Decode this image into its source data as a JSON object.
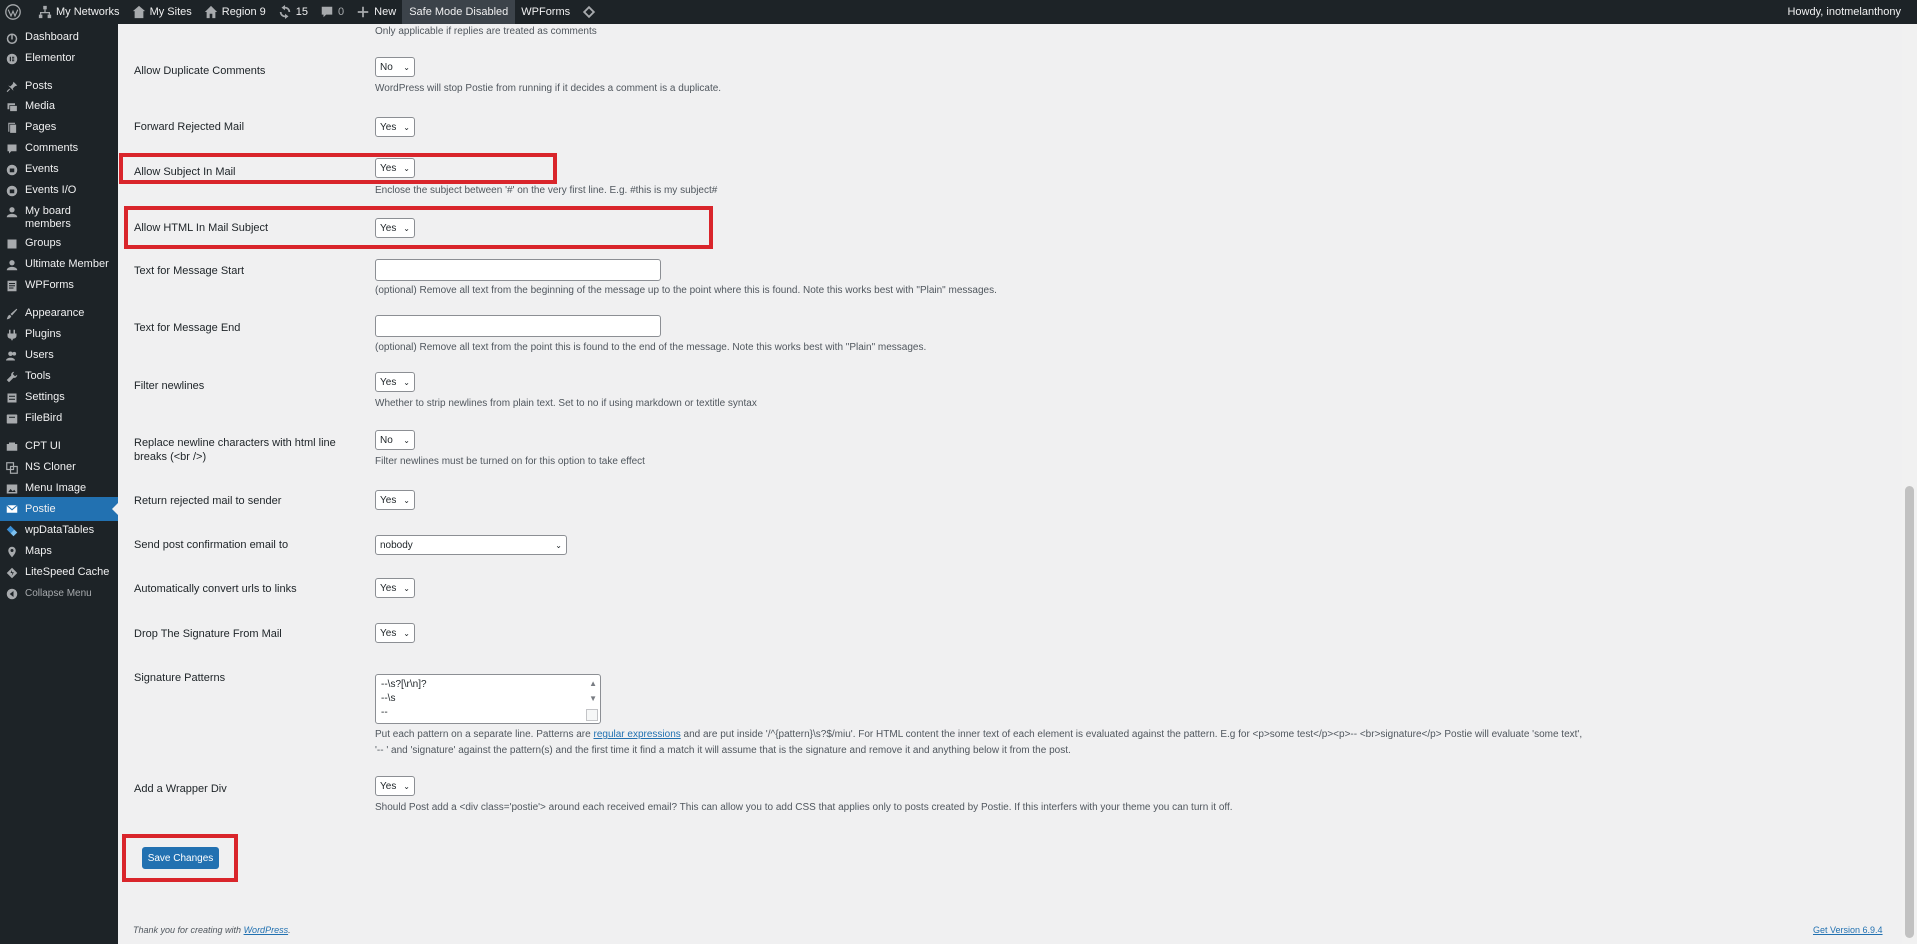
{
  "adminbar": {
    "my_networks": "My Networks",
    "my_sites": "My Sites",
    "site": "Region 9",
    "updates": "15",
    "comments": "0",
    "new": "New",
    "safe_mode": "Safe Mode Disabled",
    "wpforms": "WPForms",
    "howdy": "Howdy, inotmelanthony"
  },
  "sidebar": {
    "items": [
      {
        "label": "Dashboard",
        "icon": "dashboard-icon"
      },
      {
        "label": "Elementor",
        "icon": "elementor-icon"
      },
      {
        "label": "Posts",
        "icon": "pin-icon"
      },
      {
        "label": "Media",
        "icon": "media-icon"
      },
      {
        "label": "Pages",
        "icon": "pages-icon"
      },
      {
        "label": "Comments",
        "icon": "comment-icon"
      },
      {
        "label": "Events",
        "icon": "events-icon"
      },
      {
        "label": "Events I/O",
        "icon": "events-io-icon"
      },
      {
        "label": "My board members",
        "icon": "person-icon"
      },
      {
        "label": "Groups",
        "icon": "groups-icon"
      },
      {
        "label": "Ultimate Member",
        "icon": "user-icon"
      },
      {
        "label": "WPForms",
        "icon": "forms-icon"
      },
      {
        "label": "Appearance",
        "icon": "brush-icon"
      },
      {
        "label": "Plugins",
        "icon": "plugin-icon"
      },
      {
        "label": "Users",
        "icon": "users-icon"
      },
      {
        "label": "Tools",
        "icon": "wrench-icon"
      },
      {
        "label": "Settings",
        "icon": "settings-icon"
      },
      {
        "label": "FileBird",
        "icon": "folder-icon"
      },
      {
        "label": "CPT UI",
        "icon": "cpt-icon"
      },
      {
        "label": "NS Cloner",
        "icon": "cloner-icon"
      },
      {
        "label": "Menu Image",
        "icon": "image-icon"
      },
      {
        "label": "Postie",
        "icon": "mail-icon"
      },
      {
        "label": "wpDataTables",
        "icon": "table-icon"
      },
      {
        "label": "Maps",
        "icon": "map-pin-icon"
      },
      {
        "label": "LiteSpeed Cache",
        "icon": "litespeed-icon"
      },
      {
        "label": "Collapse Menu",
        "icon": "collapse-icon"
      }
    ]
  },
  "settings": {
    "top_note": "Only applicable if replies are treated as comments",
    "allow_duplicate": {
      "label": "Allow Duplicate Comments",
      "value": "No",
      "desc": "WordPress will stop Postie from running if it decides a comment is a duplicate."
    },
    "forward_rejected": {
      "label": "Forward Rejected Mail",
      "value": "Yes"
    },
    "allow_subject": {
      "label": "Allow Subject In Mail",
      "value": "Yes",
      "desc": "Enclose the subject between '#' on the very first line. E.g. #this is my subject#"
    },
    "allow_html_subject": {
      "label": "Allow HTML In Mail Subject",
      "value": "Yes"
    },
    "message_start": {
      "label": "Text for Message Start",
      "value": "",
      "desc": "(optional) Remove all text from the beginning of the message up to the point where this is found. Note this works best with \"Plain\" messages."
    },
    "message_end": {
      "label": "Text for Message End",
      "value": "",
      "desc": "(optional) Remove all text from the point this is found to the end of the message. Note this works best with \"Plain\" messages."
    },
    "filter_newlines": {
      "label": "Filter newlines",
      "value": "Yes",
      "desc": "Whether to strip newlines from plain text. Set to no if using markdown or textitle syntax"
    },
    "replace_newline": {
      "label_1": "Replace newline characters with html line",
      "label_2": "breaks (<br />)",
      "value": "No",
      "desc": "Filter newlines must be turned on for this option to take effect"
    },
    "return_rejected": {
      "label": "Return rejected mail to sender",
      "value": "Yes"
    },
    "send_confirmation": {
      "label": "Send post confirmation email to",
      "value": "nobody"
    },
    "convert_urls": {
      "label": "Automatically convert urls to links",
      "value": "Yes"
    },
    "drop_signature": {
      "label": "Drop The Signature From Mail",
      "value": "Yes"
    },
    "signature_patterns": {
      "label": "Signature Patterns",
      "lines": [
        "--\\s?[\\r\\n]?",
        "--\\s",
        "--"
      ],
      "desc_1a": "Put each pattern on a separate line. Patterns are ",
      "desc_link": "regular expressions",
      "desc_1b": " and are put inside '/^{pattern}\\s?$/miu'. For HTML content the inner text of each element is evaluated against the pattern. E.g for <p>some test</p><p>-- <br>signature</p> Postie will evaluate 'some text',",
      "desc_2": "'-- ' and 'signature' against the pattern(s) and the first time it find a match it will assume that is the signature and remove it and anything below it from the post."
    },
    "wrapper_div": {
      "label": "Add a Wrapper Div",
      "value": "Yes",
      "desc": "Should Post add a <div class='postie'> around each received email? This can allow you to add CSS that applies only to posts created by Postie. If this interfers with your theme you can turn it off."
    },
    "save_button": "Save Changes"
  },
  "footer": {
    "thanks": "Thank you for creating with ",
    "wp_link": "WordPress",
    "period": ".",
    "version": "Get Version 6.9.4"
  },
  "colors": {
    "highlight": "#d9252b",
    "accent": "#2271b1",
    "adminbar": "#1d2327"
  }
}
